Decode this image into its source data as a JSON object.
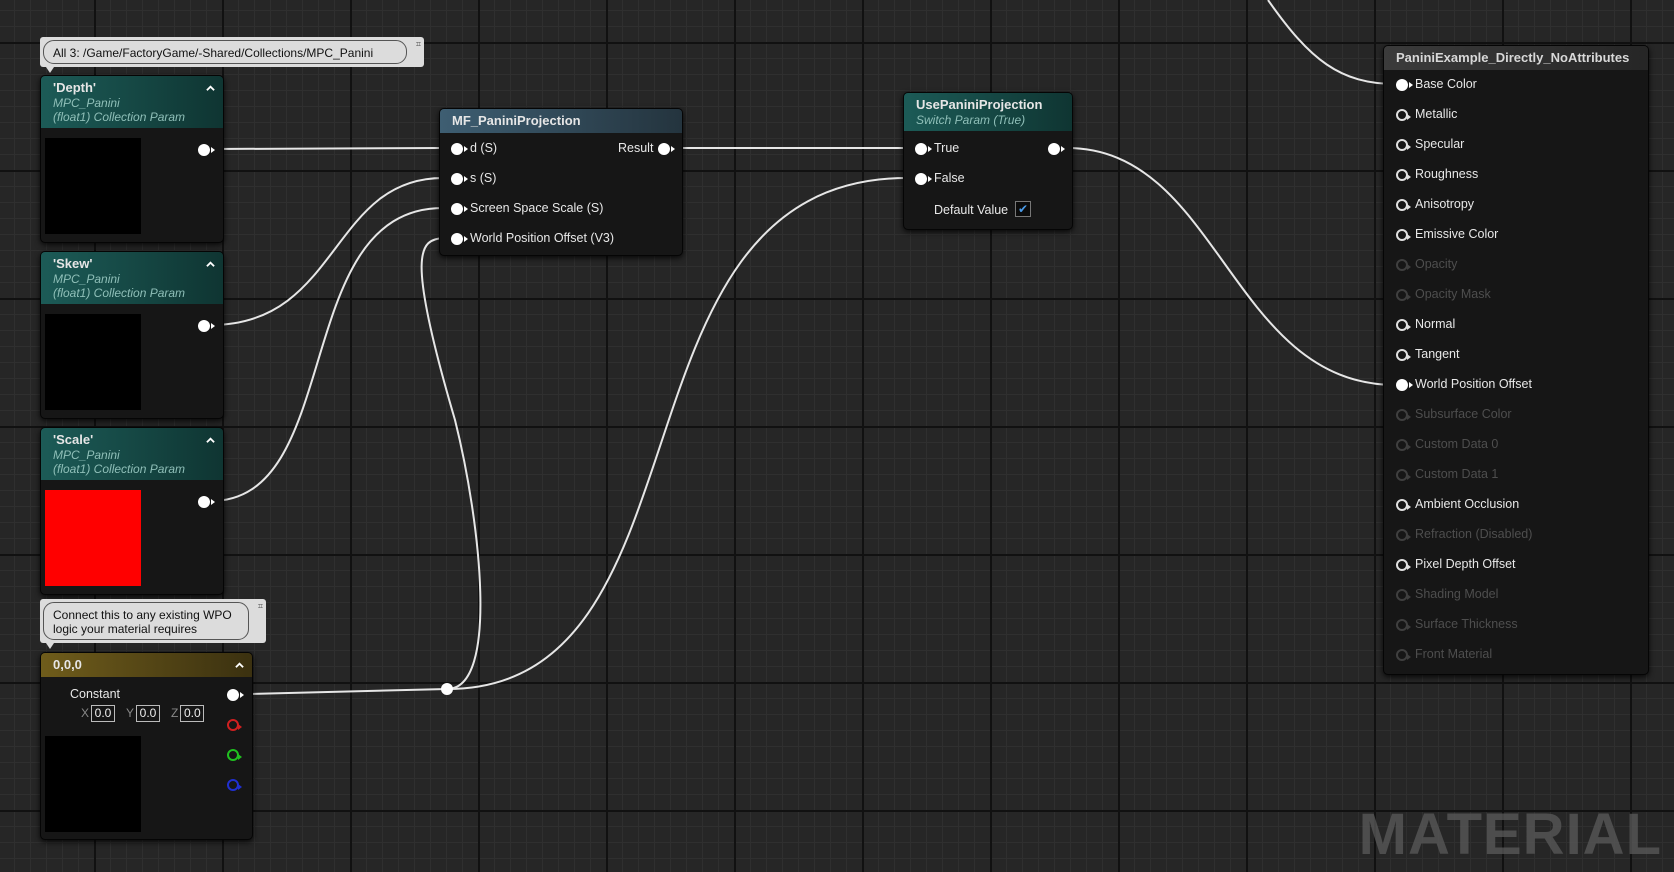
{
  "comments": {
    "top": "All 3: /Game/FactoryGame/-Shared/Collections/MPC_Panini",
    "wpo": "Connect this to any existing WPO logic your material requires"
  },
  "params": [
    {
      "title": "'Depth'",
      "collection": "MPC_Panini",
      "type": "(float1) Collection Param",
      "preview_color": "#000000"
    },
    {
      "title": "'Skew'",
      "collection": "MPC_Panini",
      "type": "(float1) Collection Param",
      "preview_color": "#000000"
    },
    {
      "title": "'Scale'",
      "collection": "MPC_Panini",
      "type": "(float1) Collection Param",
      "preview_color": "#ff0000"
    }
  ],
  "constant_node": {
    "title": "0,0,0",
    "output_label": "Constant",
    "x_label": "X",
    "x_value": "0.0",
    "y_label": "Y",
    "y_value": "0.0",
    "z_label": "Z",
    "z_value": "0.0"
  },
  "mf_node": {
    "title": "MF_PaniniProjection",
    "inputs": [
      "d (S)",
      "s (S)",
      "Screen Space Scale (S)",
      "World Position Offset (V3)"
    ],
    "output": "Result"
  },
  "switch_node": {
    "title": "UsePaniniProjection",
    "subtitle": "Switch Param (True)",
    "inputs": [
      "True",
      "False"
    ],
    "default_label": "Default Value",
    "default_checked": true
  },
  "result_node": {
    "title": "PaniniExample_Directly_NoAttributes",
    "pins": [
      {
        "label": "Base Color",
        "state": "connected"
      },
      {
        "label": "Metallic",
        "state": "enabled"
      },
      {
        "label": "Specular",
        "state": "enabled"
      },
      {
        "label": "Roughness",
        "state": "enabled"
      },
      {
        "label": "Anisotropy",
        "state": "enabled"
      },
      {
        "label": "Emissive Color",
        "state": "enabled"
      },
      {
        "label": "Opacity",
        "state": "disabled"
      },
      {
        "label": "Opacity Mask",
        "state": "disabled"
      },
      {
        "label": "Normal",
        "state": "enabled"
      },
      {
        "label": "Tangent",
        "state": "enabled"
      },
      {
        "label": "World Position Offset",
        "state": "connected"
      },
      {
        "label": "Subsurface Color",
        "state": "disabled"
      },
      {
        "label": "Custom Data 0",
        "state": "disabled"
      },
      {
        "label": "Custom Data 1",
        "state": "disabled"
      },
      {
        "label": "Ambient Occlusion",
        "state": "enabled"
      },
      {
        "label": "Refraction (Disabled)",
        "state": "disabled"
      },
      {
        "label": "Pixel Depth Offset",
        "state": "enabled"
      },
      {
        "label": "Shading Model",
        "state": "disabled"
      },
      {
        "label": "Surface Thickness",
        "state": "disabled"
      },
      {
        "label": "Front Material",
        "state": "disabled"
      }
    ]
  },
  "watermark": "MATERIAL",
  "icons": {
    "collapse": "chevron-up-icon",
    "pin": "comment-pin-icon",
    "check": "checkmark-icon"
  },
  "colors": {
    "wire": "#e6e6e6",
    "param_header": "#1c5b57",
    "function_header": "#3e5e72",
    "constant_header": "#6f5c1b"
  }
}
